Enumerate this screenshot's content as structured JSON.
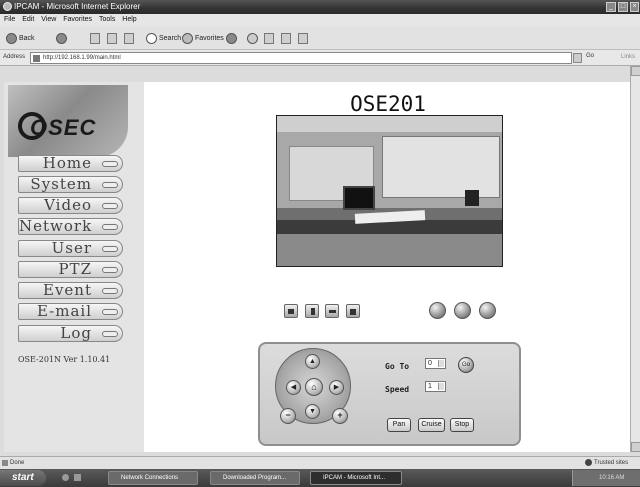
{
  "window": {
    "title": "IPCAM - Microsoft Internet Explorer",
    "menu": [
      "File",
      "Edit",
      "View",
      "Favorites",
      "Tools",
      "Help"
    ],
    "toolbar": {
      "back": "Back",
      "search": "Search",
      "favorites": "Favorites"
    },
    "address": {
      "label": "Address",
      "url": "http://192.168.1.99/main.html",
      "go": "Go",
      "links": "Links"
    },
    "status": {
      "left": "Done",
      "right": "Trusted sites"
    }
  },
  "sidebar": {
    "logo": "OSEC",
    "items": [
      {
        "label": "Home"
      },
      {
        "label": "System"
      },
      {
        "label": "Video"
      },
      {
        "label": "Network"
      },
      {
        "label": "User"
      },
      {
        "label": "PTZ"
      },
      {
        "label": "Event"
      },
      {
        "label": "E-mail"
      },
      {
        "label": "Log"
      }
    ],
    "version": "OSE-201N Ver 1.10.41"
  },
  "main": {
    "device_title": "OSE201"
  },
  "ptz": {
    "goto_label": "Go To",
    "goto_value": "0",
    "go_button": "Go",
    "speed_label": "Speed",
    "speed_value": "1",
    "pan_button": "Pan",
    "cruise_button": "Cruise",
    "stop_button": "Stop"
  },
  "taskbar": {
    "start": "start",
    "tasks": [
      "Network Connections",
      "Downloaded Program...",
      "IPCAM - Microsoft Int..."
    ],
    "clock": "10:16 AM"
  },
  "icons": {
    "ie": "internet-explorer-icon",
    "home": "home-icon"
  }
}
